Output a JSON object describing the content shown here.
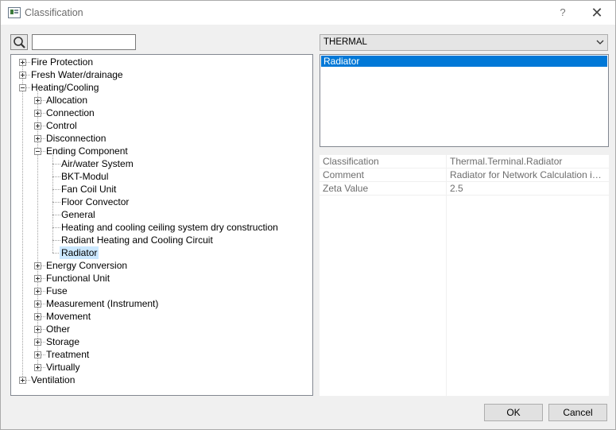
{
  "window": {
    "title": "Classification",
    "help_label": "?",
    "close_label": "✕"
  },
  "search": {
    "value": "",
    "placeholder": ""
  },
  "tree": {
    "selected": "Radiator",
    "nodes": [
      {
        "label": "Fire Protection",
        "level": 0,
        "expander": "plus"
      },
      {
        "label": "Fresh Water/drainage",
        "level": 0,
        "expander": "plus"
      },
      {
        "label": "Heating/Cooling",
        "level": 0,
        "expander": "minus"
      },
      {
        "label": "Allocation",
        "level": 1,
        "expander": "plus"
      },
      {
        "label": "Connection",
        "level": 1,
        "expander": "plus"
      },
      {
        "label": "Control",
        "level": 1,
        "expander": "plus"
      },
      {
        "label": "Disconnection",
        "level": 1,
        "expander": "plus"
      },
      {
        "label": "Ending Component",
        "level": 1,
        "expander": "minus"
      },
      {
        "label": "Air/water System",
        "level": 2,
        "expander": "none"
      },
      {
        "label": "BKT-Modul",
        "level": 2,
        "expander": "none"
      },
      {
        "label": "Fan Coil Unit",
        "level": 2,
        "expander": "none"
      },
      {
        "label": "Floor Convector",
        "level": 2,
        "expander": "none"
      },
      {
        "label": "General",
        "level": 2,
        "expander": "none"
      },
      {
        "label": "Heating and cooling ceiling system dry construction",
        "level": 2,
        "expander": "none"
      },
      {
        "label": "Radiant Heating and Cooling Circuit",
        "level": 2,
        "expander": "none"
      },
      {
        "label": "Radiator",
        "level": 2,
        "expander": "none",
        "selected": true
      },
      {
        "label": "Energy Conversion",
        "level": 1,
        "expander": "plus"
      },
      {
        "label": "Functional Unit",
        "level": 1,
        "expander": "plus"
      },
      {
        "label": "Fuse",
        "level": 1,
        "expander": "plus"
      },
      {
        "label": "Measurement (Instrument)",
        "level": 1,
        "expander": "plus"
      },
      {
        "label": "Movement",
        "level": 1,
        "expander": "plus"
      },
      {
        "label": "Other",
        "level": 1,
        "expander": "plus"
      },
      {
        "label": "Storage",
        "level": 1,
        "expander": "plus"
      },
      {
        "label": "Treatment",
        "level": 1,
        "expander": "plus"
      },
      {
        "label": "Virtually",
        "level": 1,
        "expander": "plus"
      },
      {
        "label": "Ventilation",
        "level": 0,
        "expander": "plus"
      }
    ]
  },
  "category_combo": {
    "selected": "THERMAL"
  },
  "results": {
    "items": [
      "Radiator"
    ]
  },
  "properties": {
    "rows": [
      {
        "name": "Classification",
        "value": "Thermal.Terminal.Radiator"
      },
      {
        "name": "Comment",
        "value": "Radiator for Network Calculation in General"
      },
      {
        "name": "Zeta Value",
        "value": "2.5"
      }
    ]
  },
  "buttons": {
    "ok": "OK",
    "cancel": "Cancel"
  },
  "colors": {
    "selection_blue": "#0078d7",
    "tree_selection": "#cce8ff",
    "muted_text": "#6d6d6d"
  },
  "icons": {
    "title": "classification-window-icon",
    "search": "magnifier-icon",
    "combo": "chevron-down-icon",
    "expander_plus": "plus-box-icon",
    "expander_minus": "minus-box-icon"
  }
}
